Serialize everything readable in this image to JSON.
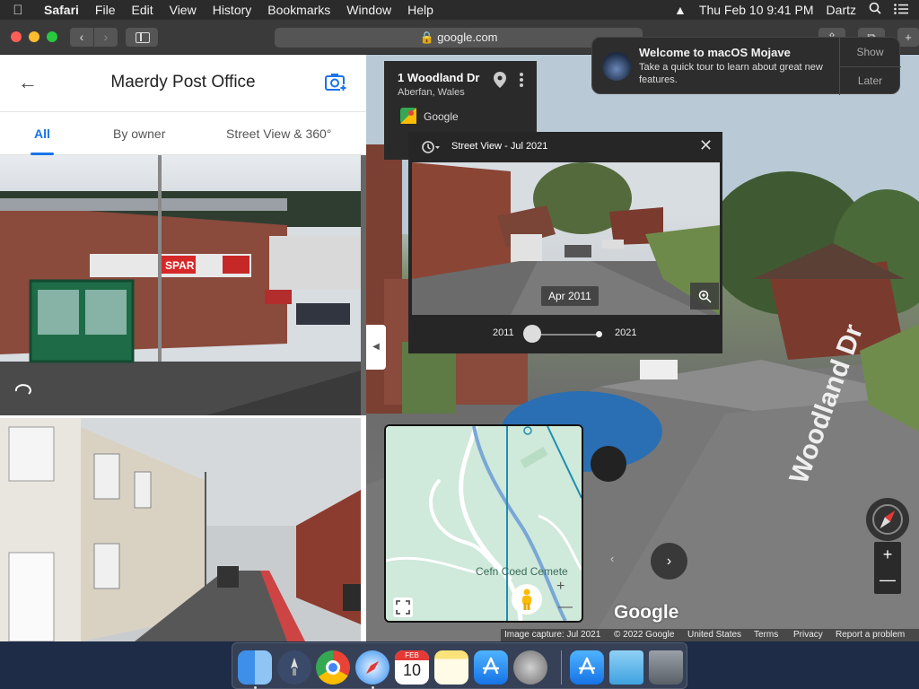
{
  "menubar": {
    "app": "Safari",
    "items": [
      "File",
      "Edit",
      "View",
      "History",
      "Bookmarks",
      "Window",
      "Help"
    ],
    "datetime": "Thu Feb 10  9:41 PM",
    "user": "Dartz"
  },
  "toolbar": {
    "url": "google.com"
  },
  "leftpanel": {
    "title": "Maerdy Post Office",
    "tabs": [
      "All",
      "By owner",
      "Street View & 360°"
    ],
    "photo1": {
      "sign_text": "SPAR"
    }
  },
  "address_card": {
    "address": "1 Woodland Dr",
    "locality": "Aberfan, Wales",
    "source": "Google"
  },
  "street_view_panel": {
    "title": "Street View - Jul 2021",
    "date_label": "Apr 2011",
    "year_start": "2011",
    "year_end": "2021",
    "slider_position": 0.0
  },
  "minimap": {
    "label": "Cefn Coed Cemete"
  },
  "street": {
    "road_sign": "Woodland Dr",
    "logo": "Google"
  },
  "footer": {
    "capture": "Image capture: Jul 2021",
    "copyright": "© 2022 Google",
    "region": "United States",
    "terms": "Terms",
    "privacy": "Privacy",
    "report": "Report a problem"
  },
  "notification": {
    "title": "Welcome to macOS Mojave",
    "body": "Take a quick tour to learn about great new features.",
    "show": "Show",
    "later": "Later"
  },
  "dock": {
    "calendar_month": "FEB",
    "calendar_day": "10"
  },
  "colors": {
    "accent": "#1a73e8",
    "menubar": "#2b2b2b",
    "toolbar": "#3a3a3a"
  }
}
